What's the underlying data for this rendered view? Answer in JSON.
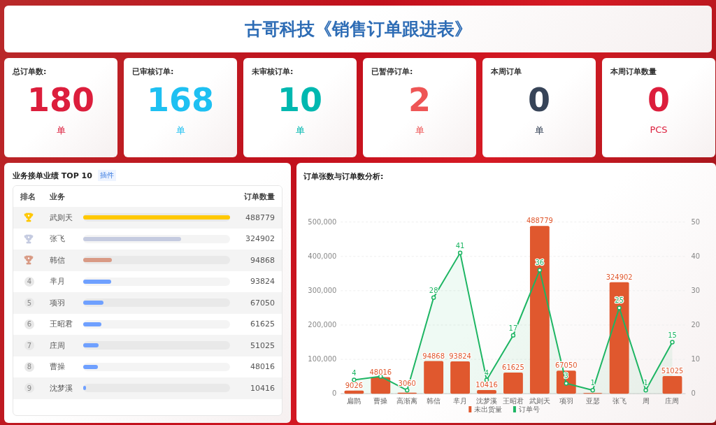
{
  "title": "古哥科技《销售订单跟进表》",
  "stats": [
    {
      "label": "总订单数:",
      "value": "180",
      "unit": "单",
      "color": "#dc1e3c"
    },
    {
      "label": "已审核订单:",
      "value": "168",
      "unit": "单",
      "color": "#1ec0f2"
    },
    {
      "label": "未审核订单:",
      "value": "10",
      "unit": "单",
      "color": "#00b8b0"
    },
    {
      "label": "已暂停订单:",
      "value": "2",
      "unit": "单",
      "color": "#ee5555"
    },
    {
      "label": "本周订单",
      "value": "0",
      "unit": "单",
      "color": "#374458"
    },
    {
      "label": "本周订单数量",
      "value": "0",
      "unit": "PCS",
      "color": "#dc1e3c"
    }
  ],
  "ranking": {
    "title": "业务接单业绩 TOP 10",
    "tag": "插件",
    "columns": [
      "排名",
      "业务",
      "订单数量"
    ],
    "rows": [
      {
        "kind": "trophy",
        "color": "#ffc800",
        "name": "武则天",
        "level": 1,
        "value": "488779"
      },
      {
        "kind": "trophy",
        "color": "#c5cbe0",
        "name": "张飞",
        "level": 0.665,
        "value": "324902"
      },
      {
        "kind": "trophy",
        "color": "#d99a85",
        "name": "韩信",
        "level": 0.194,
        "value": "94868"
      },
      {
        "kind": "number",
        "rank": "4",
        "color": "#6fa0ff",
        "name": "芈月",
        "level": 0.192,
        "value": "93824"
      },
      {
        "kind": "number",
        "rank": "5",
        "color": "#6fa0ff",
        "name": "项羽",
        "level": 0.137,
        "value": "67050"
      },
      {
        "kind": "number",
        "rank": "6",
        "color": "#6fa0ff",
        "name": "王昭君",
        "level": 0.126,
        "value": "61625"
      },
      {
        "kind": "number",
        "rank": "7",
        "color": "#6fa0ff",
        "name": "庄周",
        "level": 0.104,
        "value": "51025"
      },
      {
        "kind": "number",
        "rank": "8",
        "color": "#6fa0ff",
        "name": "曹操",
        "level": 0.098,
        "value": "48016"
      },
      {
        "kind": "number",
        "rank": "9",
        "color": "#6fa0ff",
        "name": "沈梦溪",
        "level": 0.021,
        "value": "10416"
      }
    ]
  },
  "analysis": {
    "title": "订单张数与订单数分析:",
    "chart_data": {
      "type": "bar",
      "categories": [
        "扁鹊",
        "曹操",
        "高渐离",
        "韩信",
        "芈月",
        "沈梦溪",
        "王昭君",
        "武则天",
        "项羽",
        "亚瑟",
        "张飞",
        "周",
        "庄周"
      ],
      "series": [
        {
          "name": "未出货量",
          "color": "#e0582e",
          "values": [
            9026,
            48016,
            3060,
            94868,
            93824,
            10416,
            61625,
            488779,
            67050,
            2000,
            324902,
            0,
            51025
          ],
          "value_labels": [
            "9026",
            "48016",
            "3060",
            "94868",
            "93824",
            "10416",
            "61625",
            "488779",
            "67050",
            null,
            "324902",
            null,
            "51025"
          ]
        },
        {
          "name": "订单号",
          "color": "#1db563",
          "type": "line",
          "axis": "y2",
          "marker": "circle",
          "values": [
            4,
            5,
            1,
            28,
            41,
            4,
            17,
            36,
            3,
            1,
            25,
            1,
            15
          ],
          "value_labels": [
            "4",
            null,
            null,
            "28",
            "41",
            "4",
            "17",
            "36",
            "3",
            "1",
            "25",
            "1",
            "15"
          ]
        }
      ],
      "ylim": [
        0,
        500000
      ],
      "yticks": [
        {
          "value": 0,
          "label": "0"
        },
        {
          "value": 100000,
          "label": "100,000"
        },
        {
          "value": 200000,
          "label": "200,000"
        },
        {
          "value": 300000,
          "label": "300,000"
        },
        {
          "value": 400000,
          "label": "400,000"
        },
        {
          "value": 500000,
          "label": "500,000"
        }
      ],
      "grid": true,
      "legend": true,
      "y2lim": [
        0,
        50
      ],
      "y2ticks": [
        {
          "value": 0,
          "label": "0"
        },
        {
          "value": 10,
          "label": "10"
        },
        {
          "value": 20,
          "label": "20"
        },
        {
          "value": 30,
          "label": "30"
        },
        {
          "value": 40,
          "label": "40"
        },
        {
          "value": 50,
          "label": "50"
        }
      ]
    }
  }
}
